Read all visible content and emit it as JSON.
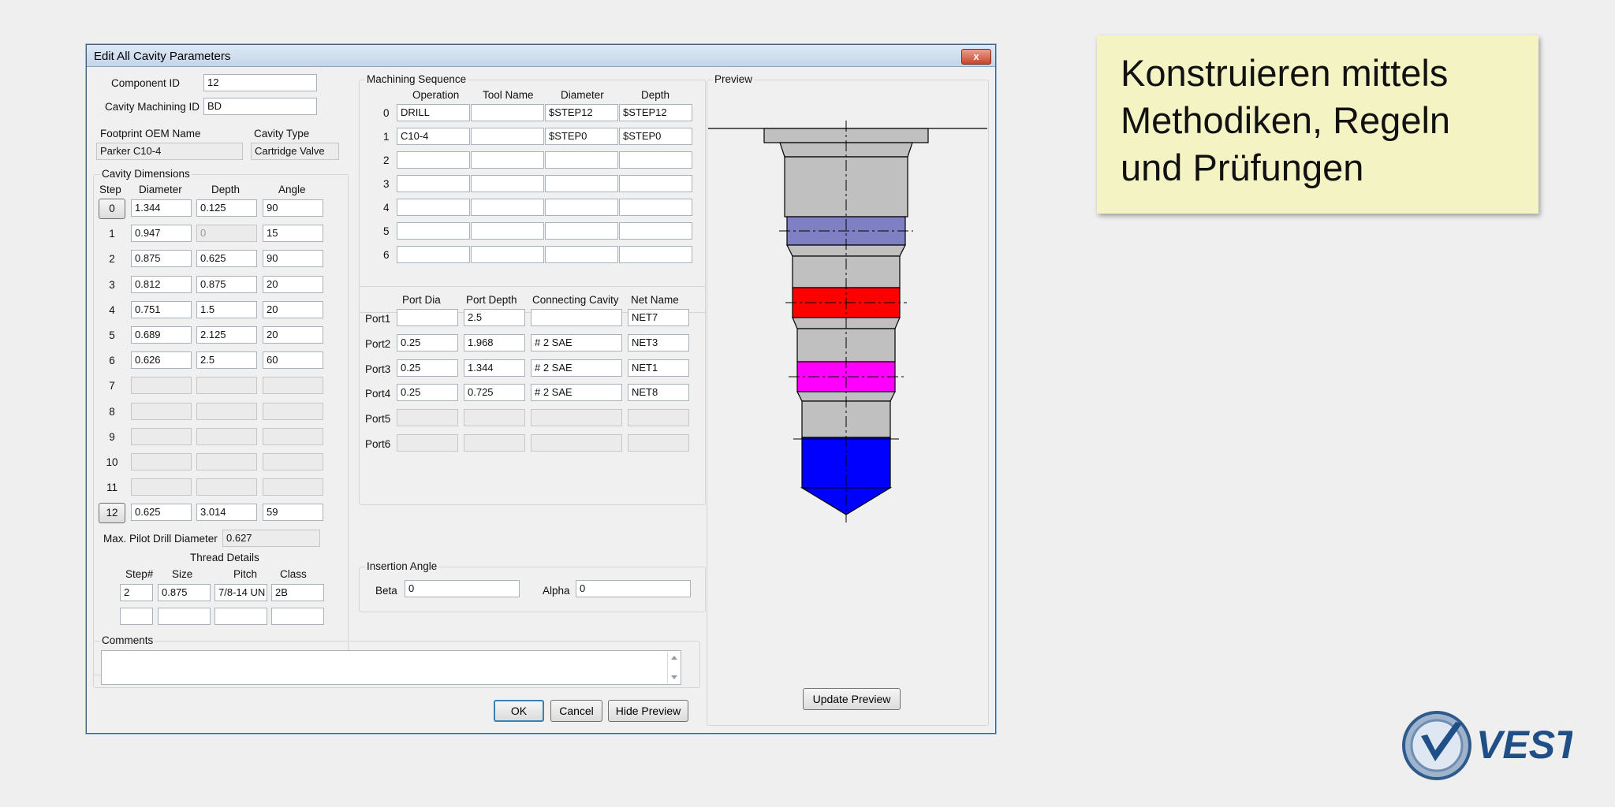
{
  "window": {
    "title": "Edit All Cavity Parameters",
    "close_glyph": "x"
  },
  "ids": {
    "component_label": "Component ID",
    "component_value": "12",
    "machining_label": "Cavity Machining ID",
    "machining_value": "BD",
    "footprint_label": "Footprint OEM Name",
    "footprint_value": "Parker C10-4",
    "cavity_type_label": "Cavity Type",
    "cavity_type_value": "Cartridge Valve"
  },
  "cavity": {
    "group_title": "Cavity Dimensions",
    "headers": [
      "Step",
      "Diameter",
      "Depth",
      "Angle"
    ],
    "rows": [
      {
        "step": "0",
        "diameter": "1.344",
        "depth": "0.125",
        "angle": "90"
      },
      {
        "step": "1",
        "diameter": "0.947",
        "depth": "0",
        "angle": "15"
      },
      {
        "step": "2",
        "diameter": "0.875",
        "depth": "0.625",
        "angle": "90"
      },
      {
        "step": "3",
        "diameter": "0.812",
        "depth": "0.875",
        "angle": "20"
      },
      {
        "step": "4",
        "diameter": "0.751",
        "depth": "1.5",
        "angle": "20"
      },
      {
        "step": "5",
        "diameter": "0.689",
        "depth": "2.125",
        "angle": "20"
      },
      {
        "step": "6",
        "diameter": "0.626",
        "depth": "2.5",
        "angle": "60"
      },
      {
        "step": "7",
        "diameter": "",
        "depth": "",
        "angle": ""
      },
      {
        "step": "8",
        "diameter": "",
        "depth": "",
        "angle": ""
      },
      {
        "step": "9",
        "diameter": "",
        "depth": "",
        "angle": ""
      },
      {
        "step": "10",
        "diameter": "",
        "depth": "",
        "angle": ""
      },
      {
        "step": "11",
        "diameter": "",
        "depth": "",
        "angle": ""
      },
      {
        "step": "12",
        "diameter": "0.625",
        "depth": "3.014",
        "angle": "59"
      }
    ],
    "pilot_label": "Max. Pilot Drill Diameter",
    "pilot_value": "0.627",
    "thread_title": "Thread Details",
    "thread_headers": [
      "Step#",
      "Size",
      "Pitch",
      "Class"
    ],
    "thread_rows": [
      {
        "step": "2",
        "size": "0.875",
        "pitch": "7/8-14 UN",
        "class": "2B"
      },
      {
        "step": "",
        "size": "",
        "pitch": "",
        "class": ""
      }
    ]
  },
  "machining": {
    "group_title": "Machining Sequence",
    "headers": [
      "Operation",
      "Tool Name",
      "Diameter",
      "Depth"
    ],
    "rows": [
      {
        "idx": "0",
        "operation": "DRILL",
        "tool": "",
        "diameter": "$STEP12",
        "depth": "$STEP12"
      },
      {
        "idx": "1",
        "operation": "C10-4",
        "tool": "",
        "diameter": "$STEP0",
        "depth": "$STEP0"
      },
      {
        "idx": "2",
        "operation": "",
        "tool": "",
        "diameter": "",
        "depth": ""
      },
      {
        "idx": "3",
        "operation": "",
        "tool": "",
        "diameter": "",
        "depth": ""
      },
      {
        "idx": "4",
        "operation": "",
        "tool": "",
        "diameter": "",
        "depth": ""
      },
      {
        "idx": "5",
        "operation": "",
        "tool": "",
        "diameter": "",
        "depth": ""
      },
      {
        "idx": "6",
        "operation": "",
        "tool": "",
        "diameter": "",
        "depth": ""
      }
    ]
  },
  "ports": {
    "headers": [
      "Port Dia",
      "Port Depth",
      "Connecting Cavity",
      "Net Name"
    ],
    "rows": [
      {
        "label": "Port1",
        "dia": "",
        "depth": "2.5",
        "cavity": "",
        "net": "NET7"
      },
      {
        "label": "Port2",
        "dia": "0.25",
        "depth": "1.968",
        "cavity": "# 2 SAE",
        "net": "NET3"
      },
      {
        "label": "Port3",
        "dia": "0.25",
        "depth": "1.344",
        "cavity": "# 2 SAE",
        "net": "NET1"
      },
      {
        "label": "Port4",
        "dia": "0.25",
        "depth": "0.725",
        "cavity": "# 2 SAE",
        "net": "NET8"
      },
      {
        "label": "Port5",
        "dia": "",
        "depth": "",
        "cavity": "",
        "net": ""
      },
      {
        "label": "Port6",
        "dia": "",
        "depth": "",
        "cavity": "",
        "net": ""
      }
    ]
  },
  "insertion": {
    "group_title": "Insertion Angle",
    "beta_label": "Beta",
    "beta_value": "0",
    "alpha_label": "Alpha",
    "alpha_value": "0"
  },
  "comments": {
    "group_title": "Comments",
    "value": ""
  },
  "buttons": {
    "ok": "OK",
    "cancel": "Cancel",
    "hide_preview": "Hide Preview",
    "update_preview": "Update Preview"
  },
  "preview": {
    "group_title": "Preview",
    "colors": {
      "body": "#c0c0c0",
      "port_blue": "#7f7fc4",
      "port_red": "#ff0000",
      "port_magenta": "#ff00ff",
      "drill": "#0000ff"
    }
  },
  "slide": {
    "note_lines": [
      "Konstruieren mittels",
      "Methodiken, Regeln",
      "und Prüfungen"
    ],
    "note_color": "#f4f3c4",
    "logo_text": "VEST"
  }
}
